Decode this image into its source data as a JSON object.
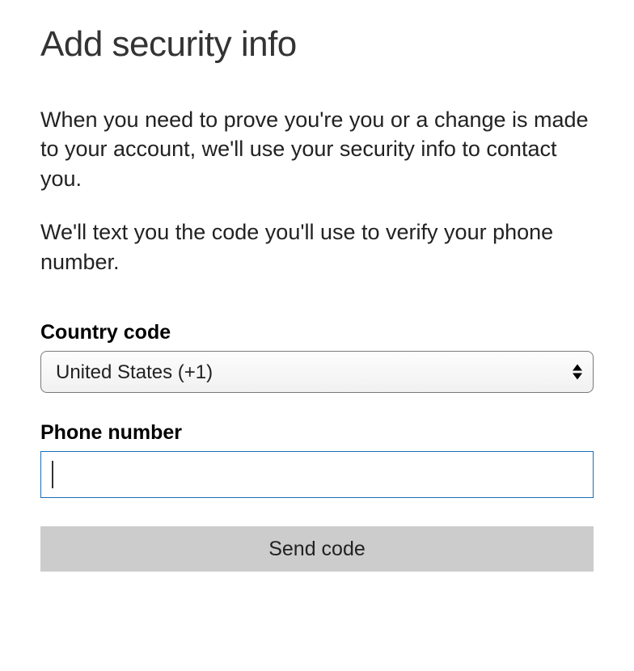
{
  "title": "Add security info",
  "description1": "When you need to prove you're you or a change is made to your account, we'll use your security info to contact you.",
  "description2": "We'll text you the code you'll use to verify your phone number.",
  "form": {
    "country_code": {
      "label": "Country code",
      "selected_value": "United States (+1)"
    },
    "phone_number": {
      "label": "Phone number",
      "value": ""
    },
    "submit_label": "Send code"
  }
}
